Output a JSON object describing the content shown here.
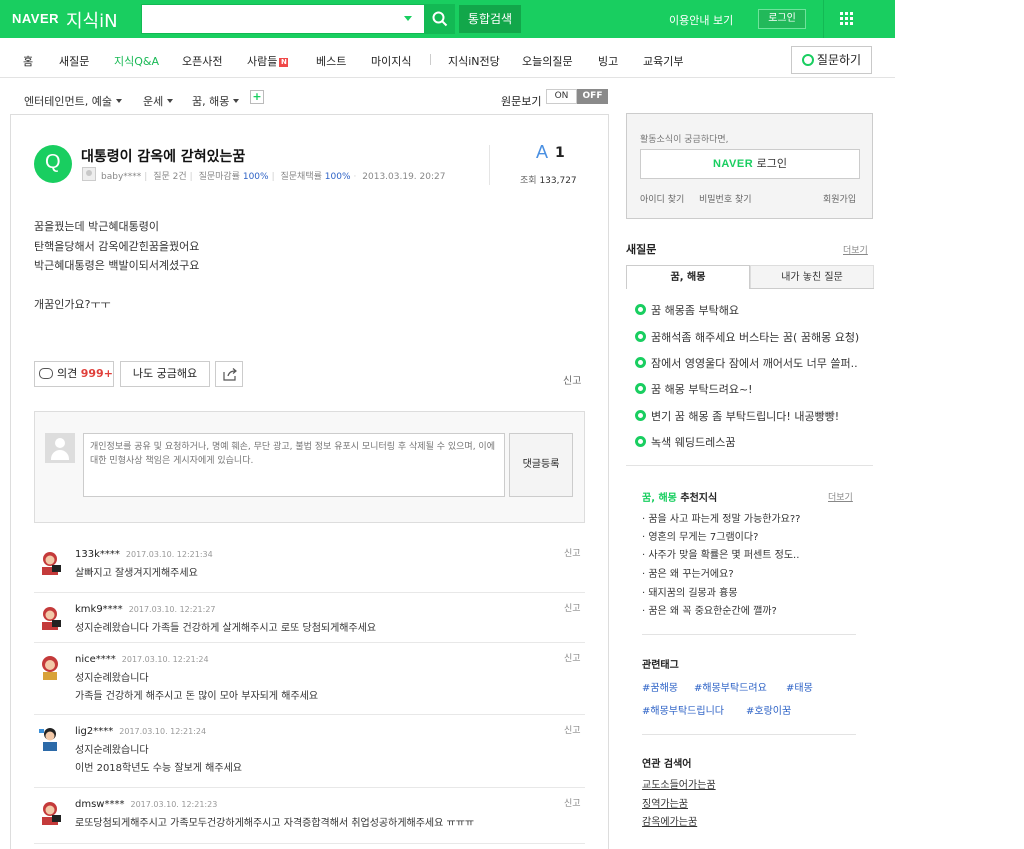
{
  "header": {
    "logo_naver": "NAVER",
    "logo_kin": "지식iN",
    "search_placeholder": "",
    "all_search": "통합검색",
    "guide": "이용안내 보기",
    "login": "로그인"
  },
  "nav": {
    "items": [
      "홈",
      "새질문",
      "지식Q&A",
      "오픈사전",
      "사람들",
      "베스트",
      "마이지식",
      "지식iN전당",
      "오늘의질문",
      "빙고",
      "교육기부"
    ],
    "badge": "N",
    "ask": "질문하기"
  },
  "breadcrumb": {
    "c1": "엔터테인먼트, 예술",
    "c2": "운세",
    "c3": "꿈, 해몽",
    "plus": "+",
    "orig_view": "원문보기",
    "on": "ON",
    "off": "OFF"
  },
  "question": {
    "icon": "Q",
    "title": "대통령이 감옥에 갇혀있는꿈",
    "author": "baby****",
    "q_count_label": "질문 2건",
    "close_label": "질문마감률",
    "close_rate": "100%",
    "adopt_label": "질문채택률",
    "adopt_rate": "100%",
    "date": "2013.03.19. 20:27",
    "answer_label": "A",
    "answer_count": "1",
    "view_label": "조회",
    "view_count": "133,727",
    "body": [
      "꿈을꿨는데 박근혜대통령이",
      "탄핵을당해서 감옥에갇힌꿈을꿨어요",
      "박근혜대통령은 백발이되서계셨구요",
      "",
      "개꿈인가요?ㅜㅜ"
    ],
    "opinion_label": "의견",
    "opinion_count": "999+",
    "curious": "나도 궁금해요",
    "report": "신고"
  },
  "comment_box": {
    "placeholder": "개인정보를 공유 및 요청하거나, 명예 훼손, 무단 광고, 불법 정보 유포시 모니터링 후 삭제될 수 있으며, 이에 대한 민형사상 책임은 게시자에게 있습니다.",
    "submit": "댓글등록"
  },
  "replies": [
    {
      "id": "133k****",
      "date": "2017.03.10. 12:21:34",
      "lines": [
        "살빠지고 잘생겨지게해주세요"
      ],
      "report": "신고"
    },
    {
      "id": "kmk9****",
      "date": "2017.03.10. 12:21:27",
      "lines": [
        "성지순례왔습니다 가족들 건강하게 살게해주시고 로또 당첨되게해주세요"
      ],
      "report": "신고"
    },
    {
      "id": "nice****",
      "date": "2017.03.10. 12:21:24",
      "lines": [
        "성지순례왔습니다",
        "가족들 건강하게 해주시고 돈 많이 모아 부자되게 해주세요"
      ],
      "report": "신고"
    },
    {
      "id": "lig2****",
      "date": "2017.03.10. 12:21:24",
      "lines": [
        "성지순례왔습니다",
        "이번 2018학년도 수능 잘보게 해주세요"
      ],
      "report": "신고"
    },
    {
      "id": "dmsw****",
      "date": "2017.03.10. 12:21:23",
      "lines": [
        "로또당첨되게해주시고 가족모두건강하게해주시고 자격증합격해서 취업성공하게해주세요 ㅠㅠㅠ"
      ],
      "report": "신고"
    }
  ],
  "sidebar": {
    "login_tip": "활동소식이 궁금하다면,",
    "login_naver": "NAVER",
    "login_label": "로그인",
    "find_id": "아이디 찾기",
    "find_pw": "비밀번호 찾기",
    "join": "회원가입",
    "new_q_title": "새질문",
    "more": "더보기",
    "tab_on": "꿈, 해몽",
    "tab_off": "내가 놓친 질문",
    "new_questions": [
      "꿈 해몽좀 부탁해요",
      "꿈해석좀 해주세요 버스타는 꿈( 꿈해몽 요청)",
      "잠에서 영영울다 잠에서 깨어서도 너무 쓸퍼..",
      "꿈 해몽 부탁드려요~!",
      "변기 꿈 해몽 좀 부탁드립니다! 내공빵빵!",
      "녹색 웨딩드레스꿈"
    ],
    "rec_title_green": "꿈, 해몽",
    "rec_title_rest": "추천지식",
    "rec_more": "더보기",
    "rec_items": [
      "· 꿈을 사고 파는게 정말 가능한가요??",
      "· 영혼의 무게는 7그램이다?",
      "· 사주가 맞을 확률은 몇 퍼센트 정도..",
      "· 꿈은 왜 꾸는거에요?",
      "· 돼지꿈의 길몽과 흉몽",
      "· 꿈은 왜 꼭 중요한순간에 깰까?"
    ],
    "tags_title": "관련태그",
    "tags": [
      "#꿈해몽",
      "#해몽부탁드려요",
      "#태몽",
      "#해몽부탁드립니다",
      "#호랑이꿈"
    ],
    "kw_title": "연관 검색어",
    "keywords": [
      "교도소들어가는꿈",
      "징역가는꿈",
      "감옥에가는꿈"
    ]
  }
}
